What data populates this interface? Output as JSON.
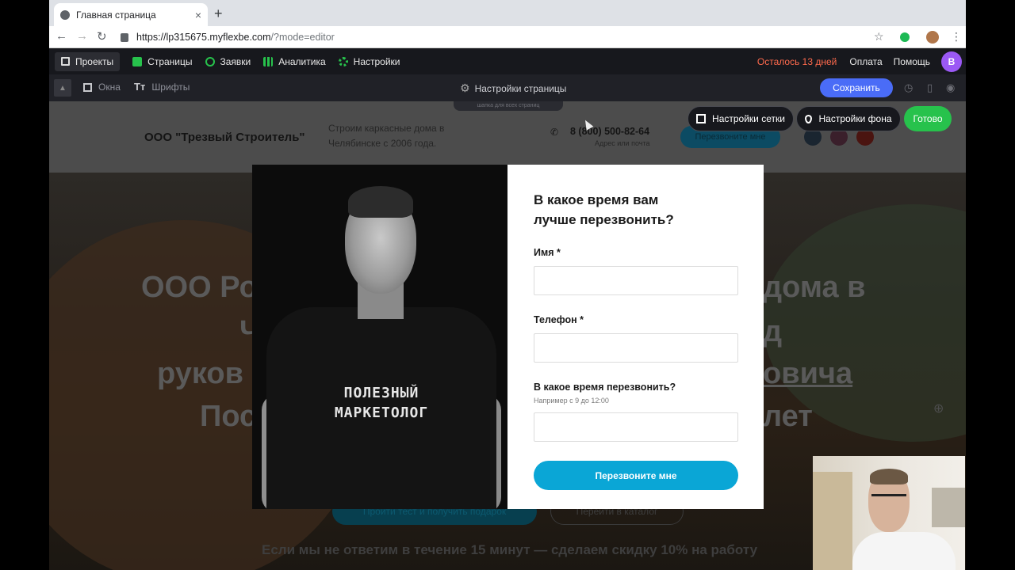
{
  "browser": {
    "tab_title": "Главная страница",
    "tab_close": "×",
    "new_tab": "+",
    "url_main": "https://lp315675.myflexbe.com",
    "url_rest": "/?mode=editor",
    "nav_back": "←",
    "nav_forward": "→",
    "nav_reload": "↻",
    "star": "☆",
    "menu": "⋮"
  },
  "appbar": {
    "items": [
      {
        "label": "Проекты",
        "icon": "home-icon"
      },
      {
        "label": "Страницы",
        "icon": "pages-icon",
        "color": "#27c24c"
      },
      {
        "label": "Заявки",
        "icon": "target-icon",
        "color": "#27c24c"
      },
      {
        "label": "Аналитика",
        "icon": "bar-chart-icon",
        "color": "#27c24c"
      },
      {
        "label": "Настройки",
        "icon": "gear-icon",
        "color": "#27c24c"
      }
    ],
    "trial": "Осталось 13 дней",
    "payment": "Оплата",
    "help": "Помощь",
    "avatar_letter": "В"
  },
  "toolbar": {
    "up_arrow": "▲",
    "windows": "Окна",
    "fonts_icon": "Tт",
    "fonts": "Шрифты",
    "page_settings": "Настройки страницы",
    "save": "Сохранить",
    "hint": "шапка для всех страниц"
  },
  "site": {
    "company": "ООО \"Трезвый Строитель\"",
    "tagline": "Строим каркасные дома в Челябинске с 2006 года.",
    "phone": "8 (800) 500-82-64",
    "phone_sub": "Адрес или почта",
    "header_cta": "Перезвоните мне",
    "hero_line1_left": "ООО Ро",
    "hero_line1_right": "дома в",
    "hero_line2_left": "Ч",
    "hero_line2_right": "д",
    "hero_line3_left": "руков",
    "hero_line3_right": "овича",
    "hero_line4_left": "Пос",
    "hero_line4_right": "лет",
    "hero_btn1": "Пройти тест и получить подарок",
    "hero_btn2": "Перейти в каталог",
    "hero_bottom": "Если мы не ответим в течение 15 минут — сделаем скидку 10% на работу"
  },
  "floating": {
    "grid_settings": "Настройки сетки",
    "bg_settings": "Настройки фона",
    "done": "Готово"
  },
  "modal": {
    "shirt_line1": "ПОЛЕЗНЫЙ",
    "shirt_line2": "МАРКЕТОЛОГ",
    "title": "В какое время вам лучше перезвонить?",
    "field1_label": "Имя *",
    "field2_label": "Телефон *",
    "field3_label": "В какое время перезвонить?",
    "field3_hint": "Например с 9 до 12:00",
    "submit": "Перезвоните мне"
  },
  "colors": {
    "accent_save": "#4a6cf7",
    "done_green": "#27c24c",
    "submit_blue": "#0aa6d6",
    "trial_red": "#ff6a4d",
    "avatar_purple": "#9b59f5"
  }
}
